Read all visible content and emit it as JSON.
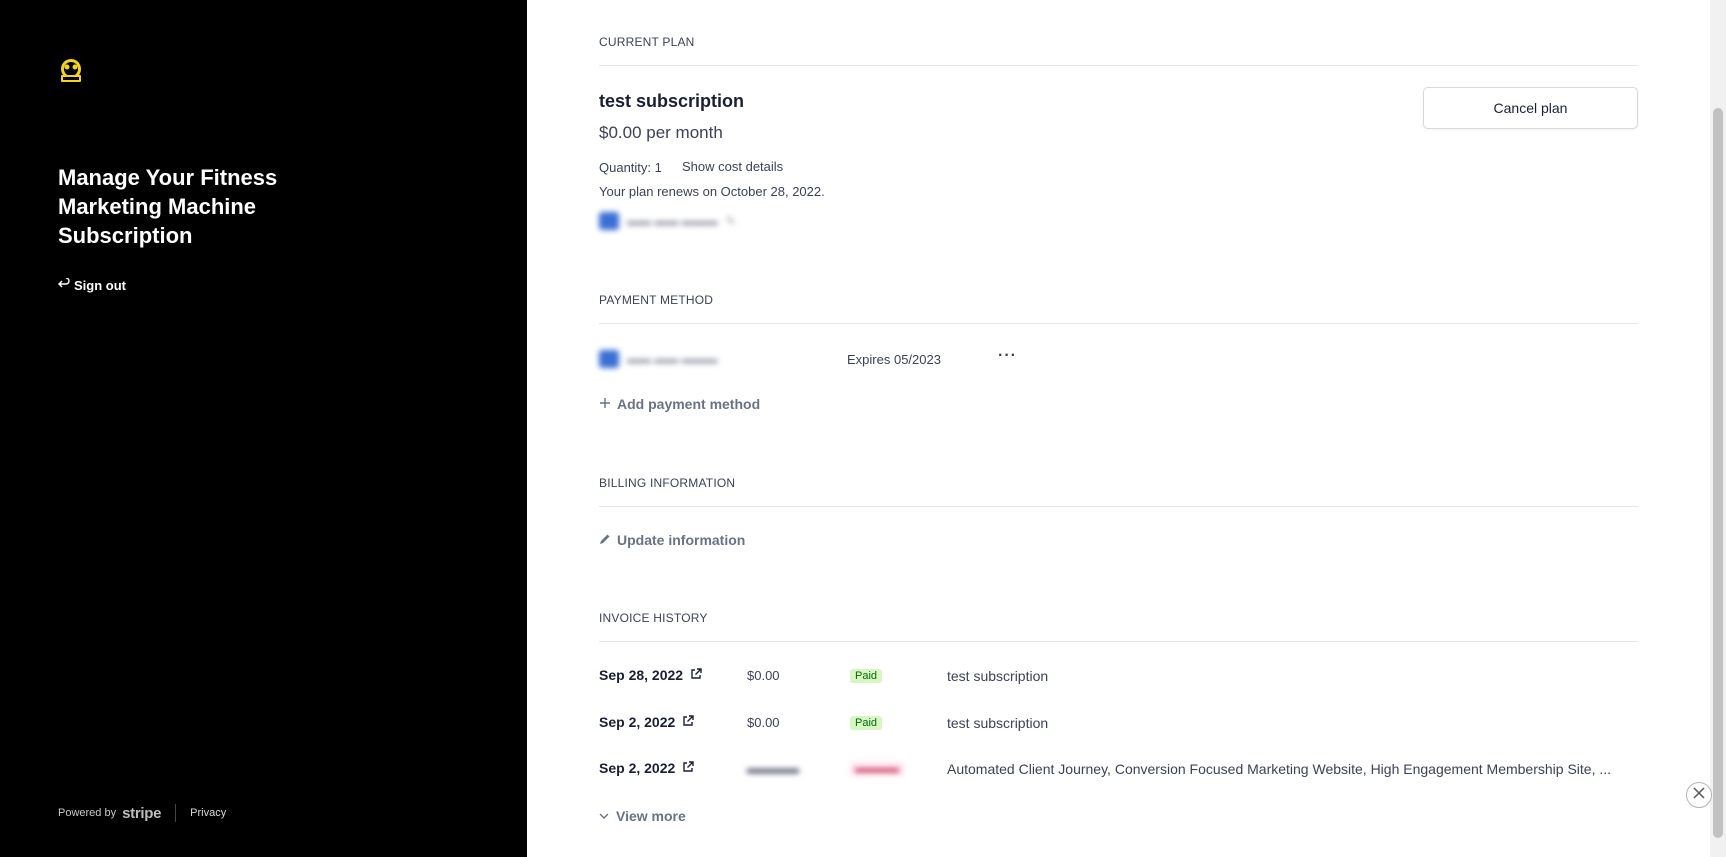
{
  "sidebar": {
    "title": "Manage Your Fitness Marketing Machine Subscription",
    "sign_out": "Sign out",
    "footer": {
      "powered_by": "Powered by",
      "brand": "stripe",
      "privacy": "Privacy"
    }
  },
  "current_plan": {
    "heading": "CURRENT PLAN",
    "plan_name": "test subscription",
    "price": "$0.00 per month",
    "quantity": "Quantity: 1",
    "cost_details_link": "Show cost details",
    "renewal": "Your plan renews on October 28, 2022.",
    "cancel_button": "Cancel plan"
  },
  "payment_method": {
    "heading": "PAYMENT METHOD",
    "expires": "Expires 05/2023",
    "more": "···",
    "add_link": "Add payment method"
  },
  "billing": {
    "heading": "BILLING INFORMATION",
    "update_link": "Update information"
  },
  "invoices": {
    "heading": "INVOICE HISTORY",
    "rows": [
      {
        "date": "Sep 28, 2022",
        "amount": "$0.00",
        "status": "Paid",
        "description": "test subscription"
      },
      {
        "date": "Sep 2, 2022",
        "amount": "$0.00",
        "status": "Paid",
        "description": "test subscription"
      },
      {
        "date": "Sep 2, 2022",
        "amount": "",
        "status": "",
        "description": "Automated Client Journey, Conversion Focused Marketing Website, High Engagement Membership Site, ..."
      }
    ],
    "view_more": "View more"
  },
  "colors": {
    "sidebar_bg": "#000000",
    "paid_badge_bg": "#d7f7c2",
    "paid_badge_text": "#05690d"
  }
}
